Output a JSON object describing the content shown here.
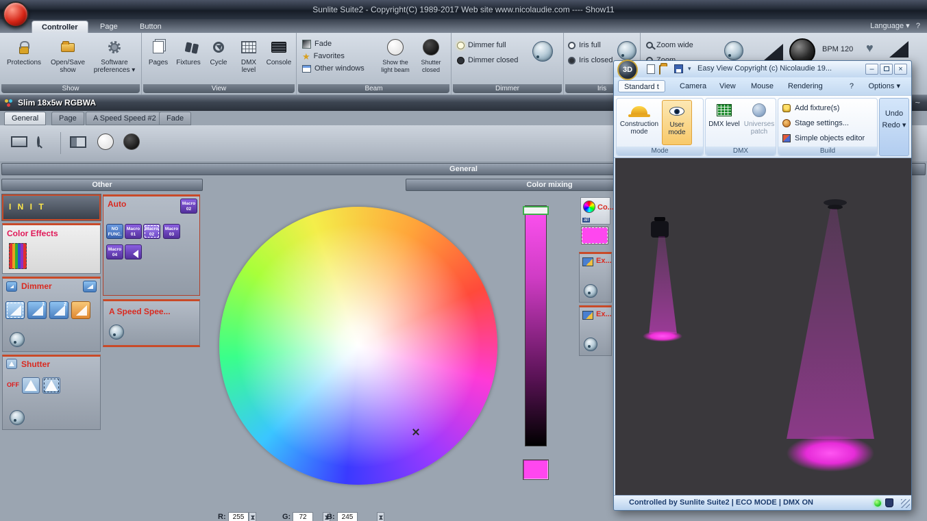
{
  "titlebar": {
    "title": "Sunlite Suite2 - Copyright(C) 1989-2017    Web site www.nicolaudie.com ---- Show11",
    "language": "Language",
    "help": "?"
  },
  "tabs": {
    "controller": "Controller",
    "page": "Page",
    "button": "Button"
  },
  "ribbon": {
    "show": {
      "label": "Show",
      "protections": "Protections",
      "open_save": "Open/Save show",
      "preferences": "Software preferences"
    },
    "view": {
      "label": "View",
      "pages": "Pages",
      "fixtures": "Fixtures",
      "cycle": "Cycle",
      "dmx_level": "DMX level",
      "console": "Console"
    },
    "beam": {
      "label": "Beam",
      "fade": "Fade",
      "favorites": "Favorites",
      "other_windows": "Other windows",
      "show_beam": "Show the light beam",
      "shutter_closed": "Shutter closed"
    },
    "dimmer": {
      "label": "Dimmer",
      "full": "Dimmer full",
      "closed": "Dimmer closed"
    },
    "iris": {
      "label": "Iris",
      "full": "Iris full",
      "closed": "Iris closed"
    },
    "zoom": {
      "wide": "Zoom wide",
      "partial": "Zoom"
    },
    "bpm": "BPM 120"
  },
  "fixture_window": {
    "title": "Slim 18x5w RGBWA",
    "tabs": [
      "General",
      "Page",
      "A Speed Speed #2",
      "Fade"
    ],
    "general_header": "General",
    "other_header": "Other",
    "color_mixing_header": "Color mixing",
    "init": "I N I T",
    "color_effects": "Color Effects",
    "dimmer_title": "Dimmer",
    "shutter_title": "Shutter",
    "off": "OFF",
    "auto_title": "Auto",
    "macro_corner": "Macro 02",
    "no_func": "NO FUNC.",
    "macro_01": "Macro 01",
    "macro_02": "Macro 02",
    "macro_03": "Macro 03",
    "macro_04": "Macro 04",
    "speed_title": "A Speed Spee...",
    "mix": {
      "color_btn": "Co...",
      "all": "all",
      "ex1": "Ex...",
      "ex2": "Ex..."
    },
    "rgb": {
      "r_label": "R:",
      "r_value": "255",
      "g_label": "G:",
      "g_value": "72",
      "b_label": "B:",
      "b_value": "245"
    }
  },
  "easy_view": {
    "logo": "3D",
    "title": "Easy View  Copyright (c) Nicolaudie 19...",
    "menu": {
      "standard": "Standard t",
      "camera": "Camera",
      "view": "View",
      "mouse": "Mouse",
      "rendering": "Rendering",
      "help": "?",
      "options": "Options"
    },
    "mode": {
      "label": "Mode",
      "construction": "Construction mode",
      "user": "User mode"
    },
    "dmx": {
      "label": "DMX",
      "dmx_level": "DMX level",
      "universes": "Universes patch"
    },
    "build": {
      "label": "Build",
      "add_fixtures": "Add fixture(s)",
      "stage_settings": "Stage settings...",
      "objects_editor": "Simple objects editor"
    },
    "undo": "Undo",
    "redo": "Redo",
    "status": "Controlled by Sunlite Suite2   |   ECO MODE   |   DMX ON"
  },
  "colors": {
    "accent_magenta": "#ff47ef",
    "selection_red": "#c94a28",
    "beam_magenta": "#fa3cf0"
  }
}
